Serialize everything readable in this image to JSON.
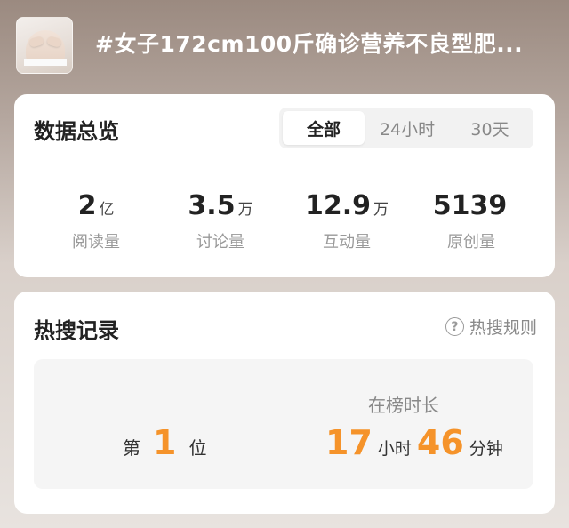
{
  "header": {
    "title": "#女子172cm100斤确诊营养不良型肥..."
  },
  "overview": {
    "title": "数据总览",
    "tabs": [
      {
        "label": "全部",
        "active": true
      },
      {
        "label": "24小时",
        "active": false
      },
      {
        "label": "30天",
        "active": false
      }
    ],
    "stats": [
      {
        "value": "2",
        "unit": "亿",
        "label": "阅读量"
      },
      {
        "value": "3.5",
        "unit": "万",
        "label": "讨论量"
      },
      {
        "value": "12.9",
        "unit": "万",
        "label": "互动量"
      },
      {
        "value": "5139",
        "unit": "",
        "label": "原创量"
      }
    ]
  },
  "hot_search": {
    "title": "热搜记录",
    "rules_label": "热搜规则",
    "rules_icon": "help-icon",
    "rank_prefix": "第",
    "rank_value": "1",
    "rank_suffix": "位",
    "duration_label": "在榜时长",
    "hours": "17",
    "hours_unit": "小时",
    "minutes": "46",
    "minutes_unit": "分钟"
  },
  "colors": {
    "accent": "#f5932a",
    "title_text": "#222222",
    "muted_text": "#999999"
  }
}
